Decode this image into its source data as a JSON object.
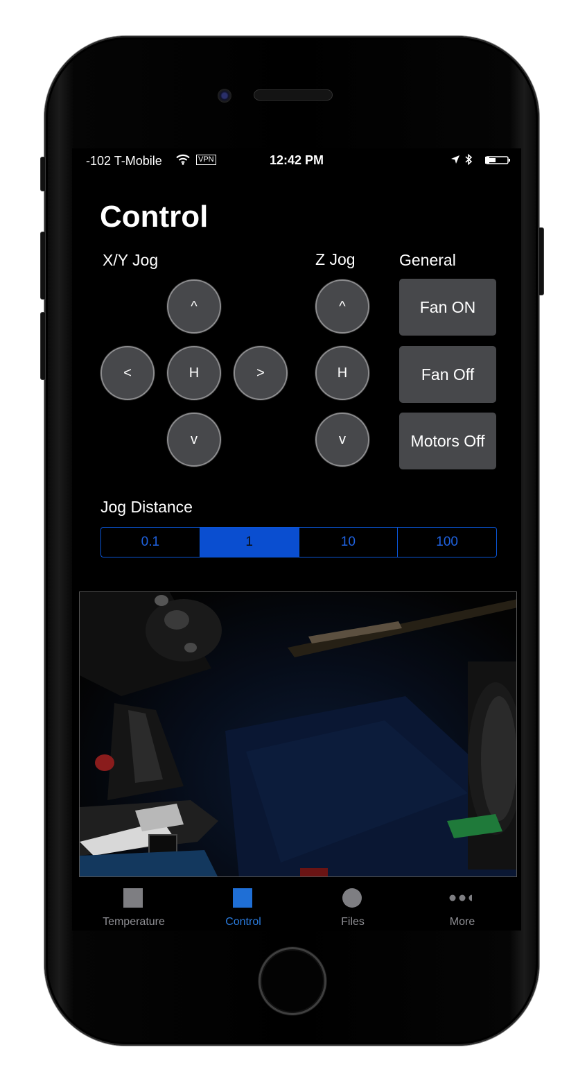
{
  "status_bar": {
    "carrier": "-102 T-Mobile",
    "vpn": "VPN",
    "time": "12:42 PM"
  },
  "header": {
    "title": "Control"
  },
  "xy_jog": {
    "label": "X/Y Jog",
    "up": "^",
    "left": "<",
    "home": "H",
    "right": ">",
    "down": "v"
  },
  "z_jog": {
    "label": "Z Jog",
    "up": "^",
    "home": "H",
    "down": "v"
  },
  "general": {
    "label": "General",
    "fan_on": "Fan ON",
    "fan_off": "Fan Off",
    "motors_off": "Motors Off"
  },
  "jog_distance": {
    "label": "Jog Distance",
    "options": [
      "0.1",
      "1",
      "10",
      "100"
    ],
    "selected": "1"
  },
  "tab_bar": {
    "items": [
      {
        "label": "Temperature",
        "icon": "square-icon"
      },
      {
        "label": "Control",
        "icon": "square-icon"
      },
      {
        "label": "Files",
        "icon": "circle-icon"
      },
      {
        "label": "More",
        "icon": "more-dots-icon"
      }
    ],
    "active": "Control"
  },
  "colors": {
    "accent": "#0a4ed0",
    "tab_active": "#2a7bde",
    "tab_inactive": "#8e8e93",
    "button_bg": "#47484b"
  }
}
